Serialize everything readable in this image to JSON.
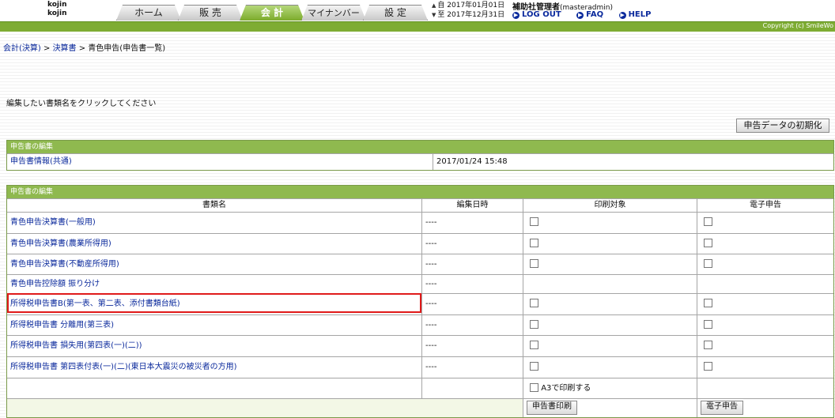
{
  "header": {
    "users": [
      "kojin",
      "kojin"
    ],
    "tabs": [
      {
        "label": "ホーム",
        "active": false
      },
      {
        "label": "販 売",
        "active": false
      },
      {
        "label": "会 計",
        "active": true
      },
      {
        "label": "マイナンバー",
        "active": false
      },
      {
        "label": "設 定",
        "active": false
      }
    ],
    "date_from_label": "自",
    "date_from": "2017年01月01日",
    "date_to_label": "至",
    "date_to": "2017年12月31日",
    "admin_name": "補助社管理者",
    "admin_id": "(masteradmin)",
    "links": [
      "LOG OUT",
      "FAQ",
      "HELP"
    ],
    "copyright": "Copyright (c) SmileWo",
    "accent_color": "#7eac33"
  },
  "breadcrumb": {
    "items": [
      "会計(決算)",
      "決算書"
    ],
    "separator": " > ",
    "current": "青色申告(申告書一覧)"
  },
  "instruction": "編集したい書類名をクリックしてください",
  "init_button": "申告データの初期化",
  "section1": {
    "title": "申告書の編集",
    "row_label": "申告書情報(共通)",
    "row_date": "2017/01/24 15:48"
  },
  "section2": {
    "title": "申告書の編集",
    "columns": [
      "書類名",
      "編集日時",
      "印刷対象",
      "電子申告"
    ],
    "rows": [
      {
        "name": "青色申告決算書(一般用)",
        "date": "----",
        "print": true,
        "efile": true
      },
      {
        "name": "青色申告決算書(農業所得用)",
        "date": "----",
        "print": true,
        "efile": true
      },
      {
        "name": "青色申告決算書(不動産所得用)",
        "date": "----",
        "print": true,
        "efile": true
      },
      {
        "name": "青色申告控除額 振り分け",
        "date": "----",
        "print": false,
        "efile": false
      },
      {
        "name": "所得税申告書B(第一表、第二表、添付書類台紙)",
        "date": "----",
        "print": true,
        "efile": true
      },
      {
        "name": "所得税申告書 分離用(第三表)",
        "date": "----",
        "print": true,
        "efile": true
      },
      {
        "name": "所得税申告書 損失用(第四表(一)(二))",
        "date": "----",
        "print": true,
        "efile": true
      },
      {
        "name": "所得税申告書 第四表付表(一)(二)(東日本大震災の被災者の方用)",
        "date": "----",
        "print": true,
        "efile": true
      }
    ],
    "a3_label": "A3で印刷する",
    "print_button": "申告書印刷",
    "efile_button": "電子申告"
  }
}
